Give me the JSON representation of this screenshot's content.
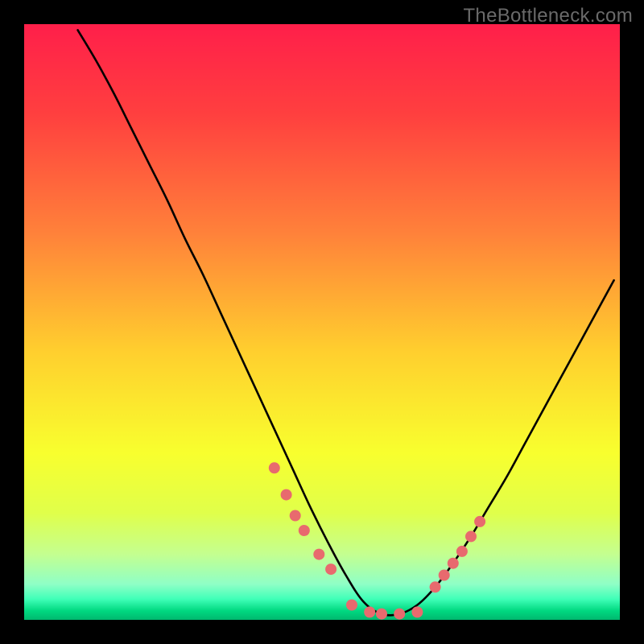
{
  "watermark": "TheBottleneck.com",
  "chart_data": {
    "type": "line",
    "title": "",
    "xlabel": "",
    "ylabel": "",
    "xlim": [
      0,
      100
    ],
    "ylim": [
      0,
      100
    ],
    "grid": false,
    "legend": false,
    "description": "Asymmetric V-curve (bottleneck profile). Y=100 is top (red), Y=0 is bottom (green). Curve descends steeply from top-left, reaches near-zero around x≈57-63, then rises on the right.",
    "series": [
      {
        "name": "curve",
        "x": [
          9,
          12,
          15,
          18,
          21,
          24,
          27,
          30,
          33,
          36,
          39,
          42,
          45,
          48,
          51,
          54,
          57,
          60,
          63,
          66,
          69,
          72,
          75,
          78,
          81,
          84,
          87,
          90,
          93,
          96,
          99
        ],
        "values": [
          99,
          94,
          88.5,
          82.5,
          76.5,
          70.5,
          64,
          58,
          51.5,
          45,
          38.5,
          32,
          25.5,
          19,
          13,
          7.5,
          3,
          1,
          1,
          2.5,
          5.5,
          9.5,
          14,
          19,
          24,
          29.5,
          35,
          40.5,
          46,
          51.5,
          57
        ]
      }
    ],
    "markers": {
      "name": "dots",
      "color": "#e86a6e",
      "x": [
        42.0,
        44.0,
        45.5,
        47.0,
        49.5,
        51.5,
        55.0,
        58.0,
        60.0,
        63.0,
        66.0,
        69.0,
        70.5,
        72.0,
        73.5,
        75.0,
        76.5
      ],
      "y": [
        25.5,
        21.0,
        17.5,
        15.0,
        11.0,
        8.5,
        2.5,
        1.3,
        1.0,
        1.0,
        1.3,
        5.5,
        7.5,
        9.5,
        11.5,
        14.0,
        16.5
      ]
    },
    "gradient_stops": [
      {
        "offset": 0.0,
        "color": "#ff1f4a"
      },
      {
        "offset": 0.15,
        "color": "#ff3f3f"
      },
      {
        "offset": 0.35,
        "color": "#ff813a"
      },
      {
        "offset": 0.55,
        "color": "#ffcf2e"
      },
      {
        "offset": 0.72,
        "color": "#f8ff2e"
      },
      {
        "offset": 0.82,
        "color": "#e0ff4a"
      },
      {
        "offset": 0.89,
        "color": "#c4ff90"
      },
      {
        "offset": 0.94,
        "color": "#8fffc6"
      },
      {
        "offset": 0.965,
        "color": "#40ffb8"
      },
      {
        "offset": 0.985,
        "color": "#00d880"
      },
      {
        "offset": 1.0,
        "color": "#00b86f"
      }
    ]
  }
}
